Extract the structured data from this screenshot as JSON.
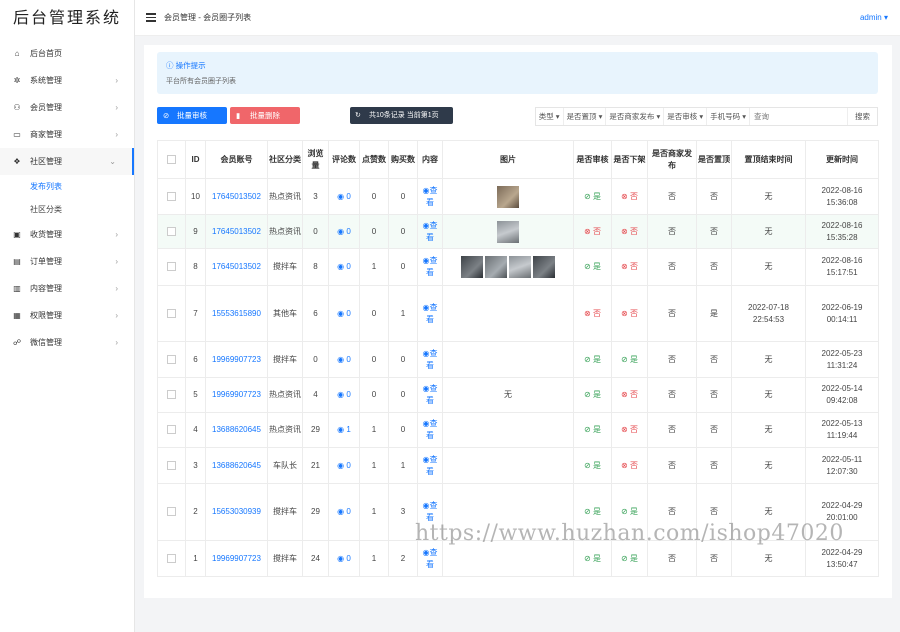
{
  "sidebar": {
    "logo": "后台管理系统",
    "items": [
      {
        "label": "后台首页",
        "icon": "home-icon"
      },
      {
        "label": "系统管理",
        "icon": "gear-icon",
        "arrow": "›"
      },
      {
        "label": "会员管理",
        "icon": "users-icon",
        "arrow": "›"
      },
      {
        "label": "商家管理",
        "icon": "store-icon",
        "arrow": "›"
      },
      {
        "label": "社区管理",
        "icon": "dropbox-icon",
        "arrow": "⌄"
      },
      {
        "label": "收货管理",
        "icon": "box-icon",
        "arrow": "›"
      },
      {
        "label": "订单管理",
        "icon": "clipboard-icon",
        "arrow": "›"
      },
      {
        "label": "内容管理",
        "icon": "file-icon",
        "arrow": "›"
      },
      {
        "label": "权限管理",
        "icon": "id-card-icon",
        "arrow": "›"
      },
      {
        "label": "微信管理",
        "icon": "wechat-icon",
        "arrow": "›"
      }
    ],
    "sub_items": [
      "发布列表",
      "社区分类"
    ]
  },
  "header": {
    "breadcrumb": "会员管理 - 会员圈子列表",
    "user": "admin ▾"
  },
  "tip": {
    "title": "ⓘ 操作提示",
    "text": "平台所有会员圈子列表"
  },
  "toolbar": {
    "batch_review": "批量审核",
    "batch_delete": "批量删除",
    "count_text": "共10条记录 当前第1页",
    "filters": [
      "类型 ▾",
      "是否置顶 ▾",
      "是否商家发布 ▾",
      "是否审核 ▾",
      "手机号码 ▾"
    ],
    "search_placeholder": "查询",
    "search_button": "搜索"
  },
  "colors": {
    "accent": "#1677ff",
    "danger": "#f0666a",
    "success": "#3aa35a"
  },
  "table": {
    "headers": [
      "",
      "ID",
      "会员账号",
      "社区分类",
      "浏览量",
      "评论数",
      "点赞数",
      "购买数",
      "内容",
      "图片",
      "是否审核",
      "是否下架",
      "是否商家发布",
      "是否置顶",
      "置顶结束时间",
      "更新时间"
    ],
    "rows": [
      {
        "id": "10",
        "account": "17645013502",
        "category": "热点资讯",
        "views": "3",
        "comments": "◉ 0",
        "likes": "0",
        "buys": "0",
        "content": "◉查看",
        "pics": [
          "brown"
        ],
        "pic_text": "",
        "audit": "⊘ 是",
        "audit_ok": true,
        "off": "⊗ 否",
        "off_ok": false,
        "merchant": "否",
        "top": "否",
        "top_end": "无",
        "updated": "2022-08-16 15:36:08"
      },
      {
        "id": "9",
        "account": "17645013502",
        "category": "热点资讯",
        "views": "0",
        "comments": "◉ 0",
        "likes": "0",
        "buys": "0",
        "content": "◉查看",
        "pics": [
          "grey2"
        ],
        "pic_text": "",
        "audit": "⊗ 否",
        "audit_ok": false,
        "off": "⊗ 否",
        "off_ok": false,
        "merchant": "否",
        "top": "否",
        "top_end": "无",
        "updated": "2022-08-16 15:35:28"
      },
      {
        "id": "8",
        "account": "17645013502",
        "category": "搅拌车",
        "views": "8",
        "comments": "◉ 0",
        "likes": "1",
        "buys": "0",
        "content": "◉查看",
        "pics": [
          "dark",
          "",
          "grey2",
          "dark"
        ],
        "pic_text": "",
        "audit": "⊘ 是",
        "audit_ok": true,
        "off": "⊗ 否",
        "off_ok": false,
        "merchant": "否",
        "top": "否",
        "top_end": "无",
        "updated": "2022-08-16 15:17:51"
      },
      {
        "id": "7",
        "account": "15553615890",
        "category": "其他车",
        "views": "6",
        "comments": "◉ 0",
        "likes": "0",
        "buys": "1",
        "content": "◉查看",
        "pics": [],
        "pic_text": "",
        "audit": "⊗ 否",
        "audit_ok": false,
        "off": "⊗ 否",
        "off_ok": false,
        "merchant": "否",
        "top": "是",
        "top_end": "2022-07-18 22:54:53",
        "updated": "2022-06-19 00:14:11"
      },
      {
        "id": "6",
        "account": "19969907723",
        "category": "搅拌车",
        "views": "0",
        "comments": "◉ 0",
        "likes": "0",
        "buys": "0",
        "content": "◉查看",
        "pics": [],
        "pic_text": "",
        "audit": "⊘ 是",
        "audit_ok": true,
        "off": "⊘ 是",
        "off_ok": true,
        "merchant": "否",
        "top": "否",
        "top_end": "无",
        "updated": "2022-05-23 11:31:24"
      },
      {
        "id": "5",
        "account": "19969907723",
        "category": "热点资讯",
        "views": "4",
        "comments": "◉ 0",
        "likes": "0",
        "buys": "0",
        "content": "◉查看",
        "pics": [],
        "pic_text": "无",
        "audit": "⊘ 是",
        "audit_ok": true,
        "off": "⊗ 否",
        "off_ok": false,
        "merchant": "否",
        "top": "否",
        "top_end": "无",
        "updated": "2022-05-14 09:42:08"
      },
      {
        "id": "4",
        "account": "13688620645",
        "category": "热点资讯",
        "views": "29",
        "comments": "◉ 1",
        "likes": "1",
        "buys": "0",
        "content": "◉查看",
        "pics": [],
        "pic_text": "",
        "audit": "⊘ 是",
        "audit_ok": true,
        "off": "⊗ 否",
        "off_ok": false,
        "merchant": "否",
        "top": "否",
        "top_end": "无",
        "updated": "2022-05-13 11:19:44"
      },
      {
        "id": "3",
        "account": "13688620645",
        "category": "车队长",
        "views": "21",
        "comments": "◉ 0",
        "likes": "1",
        "buys": "1",
        "content": "◉查看",
        "pics": [],
        "pic_text": "",
        "audit": "⊘ 是",
        "audit_ok": true,
        "off": "⊗ 否",
        "off_ok": false,
        "merchant": "否",
        "top": "否",
        "top_end": "无",
        "updated": "2022-05-11 12:07:30"
      },
      {
        "id": "2",
        "account": "15653030939",
        "category": "搅拌车",
        "views": "29",
        "comments": "◉ 0",
        "likes": "1",
        "buys": "3",
        "content": "◉查看",
        "pics": [],
        "pic_text": "",
        "audit": "⊘ 是",
        "audit_ok": true,
        "off": "⊘ 是",
        "off_ok": true,
        "merchant": "否",
        "top": "否",
        "top_end": "无",
        "updated": "2022-04-29 20:01:00"
      },
      {
        "id": "1",
        "account": "19969907723",
        "category": "搅拌车",
        "views": "24",
        "comments": "◉ 0",
        "likes": "1",
        "buys": "2",
        "content": "◉查看",
        "pics": [],
        "pic_text": "",
        "audit": "⊘ 是",
        "audit_ok": true,
        "off": "⊘ 是",
        "off_ok": true,
        "merchant": "否",
        "top": "否",
        "top_end": "无",
        "updated": "2022-04-29 13:50:47"
      }
    ]
  },
  "watermark": "https://www.huzhan.com/ishop47020"
}
